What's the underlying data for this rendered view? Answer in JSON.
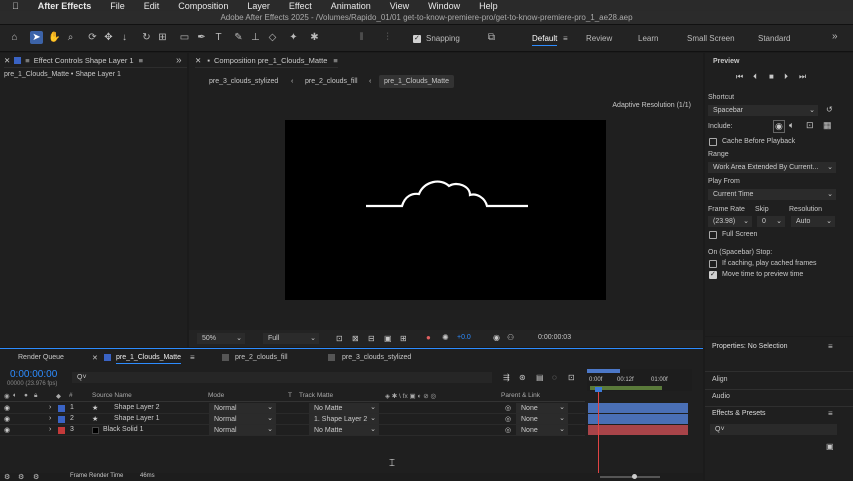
{
  "menu": {
    "apple": "",
    "app": "After Effects",
    "items": [
      "File",
      "Edit",
      "Composition",
      "Layer",
      "Effect",
      "Animation",
      "View",
      "Window",
      "Help"
    ]
  },
  "window_title": "Adobe After Effects 2025 - /Volumes/Rapido_01/01 get-to-know-premiere-pro/get-to-know-premiere-pro_1_ae28.aep",
  "toolbar": {
    "snapping_label": "Snapping",
    "snapping_checked": true,
    "workspaces": [
      "Default",
      "Review",
      "Learn",
      "Small Screen",
      "Standard"
    ],
    "active_workspace": "Default",
    "more": "»"
  },
  "left_panel": {
    "tab_label": "Effect Controls Shape Layer 1",
    "subtitle": "pre_1_Clouds_Matte • Shape Layer 1",
    "more": "»"
  },
  "comp_panel": {
    "tab_label": "Composition pre_1_Clouds_Matte",
    "breadcrumbs": [
      "pre_3_clouds_stylized",
      "pre_2_clouds_fill",
      "pre_1_Clouds_Matte"
    ],
    "adaptive_resolution": "Adaptive Resolution (1/1)",
    "zoom": "50%",
    "quality": "Full",
    "exposure": "+0.0",
    "timecode": "0:00:00:03",
    "accent": "#2d8cff"
  },
  "preview": {
    "title": "Preview",
    "shortcut_label": "Shortcut",
    "shortcut_value": "Spacebar",
    "include_label": "Include:",
    "cache_before_playback": "Cache Before Playback",
    "range_label": "Range",
    "range_value": "Work Area Extended By Current...",
    "play_from_label": "Play From",
    "play_from_value": "Current Time",
    "frame_rate_label": "Frame Rate",
    "skip_label": "Skip",
    "resolution_label": "Resolution",
    "frame_rate_value": "(23.98)",
    "skip_value": "0",
    "resolution_value": "Auto",
    "full_screen": "Full Screen",
    "stop_label": "On (Spacebar) Stop:",
    "if_caching": "If caching, play cached frames",
    "move_time": "Move time to preview time",
    "move_time_checked": true
  },
  "right_panels": {
    "properties": "Properties: No Selection",
    "align": "Align",
    "audio": "Audio",
    "effects_presets": "Effects & Presets",
    "search_placeholder": "Q˅"
  },
  "timeline": {
    "tabs": [
      "Render Queue",
      "pre_1_Clouds_Matte",
      "pre_2_clouds_fill",
      "pre_3_clouds_stylized"
    ],
    "active_tab": "pre_1_Clouds_Matte",
    "timecode": "0:00:00:00",
    "fps": "00000 (23.976 fps)",
    "search_placeholder": "Q˅",
    "columns": {
      "source_name": "Source Name",
      "mode": "Mode",
      "t": "T",
      "track_matte": "Track Matte",
      "parent": "Parent & Link"
    },
    "ruler": [
      "0:00f",
      "00:12f",
      "01:00f"
    ],
    "layers": [
      {
        "num": "1",
        "name": "Shape Layer 2",
        "mode": "Normal",
        "matte": "No Matte",
        "parent": "None",
        "color": "#3a63c4",
        "bar": "#4a6fb5"
      },
      {
        "num": "2",
        "name": "Shape Layer 1",
        "mode": "Normal",
        "matte": "1. Shape Layer 2",
        "parent": "None",
        "color": "#3a63c4",
        "bar": "#4a6fb5"
      },
      {
        "num": "3",
        "name": "Black Solid 1",
        "mode": "Normal",
        "matte": "No Matte",
        "parent": "None",
        "color": "#c43a3a",
        "bar": "#a84449"
      }
    ],
    "frame_render_label": "Frame Render Time",
    "frame_render_value": "46ms"
  }
}
